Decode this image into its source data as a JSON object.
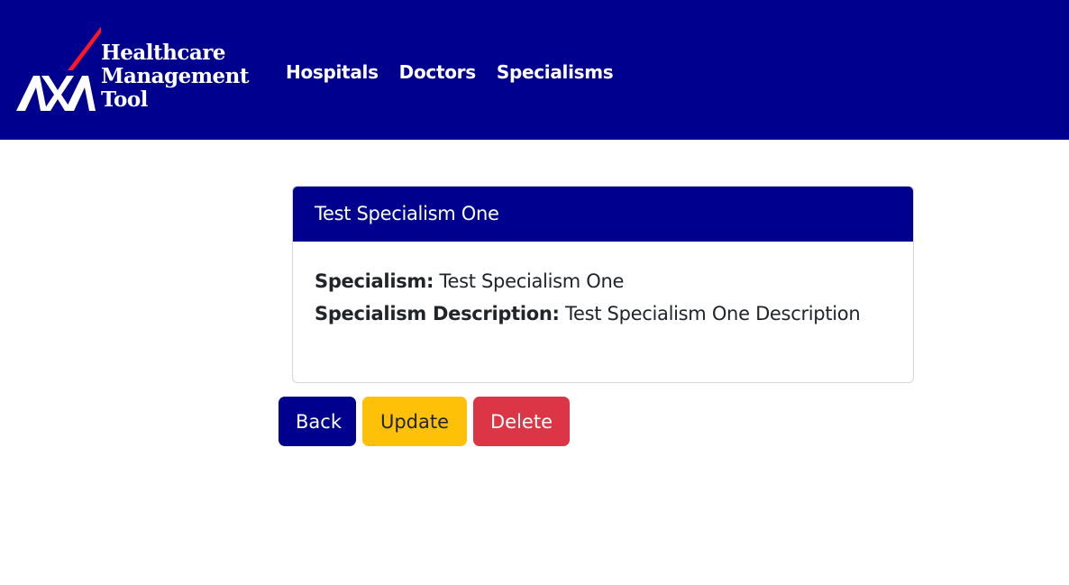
{
  "colors": {
    "brand": "#00008f",
    "warning": "#ffc107",
    "danger": "#dc3545",
    "logo_slash": "#ff1721"
  },
  "brand": {
    "logo_mark": "AXA",
    "line1": "Healthcare",
    "line2": "Management",
    "line3": "Tool"
  },
  "nav": {
    "hospitals": "Hospitals",
    "doctors": "Doctors",
    "specialisms": "Specialisms"
  },
  "card": {
    "title": "Test Specialism One",
    "fields": [
      {
        "label": "Specialism:",
        "value": "Test Specialism One"
      },
      {
        "label": "Specialism Description:",
        "value": "Test Specialism One Description"
      }
    ]
  },
  "actions": {
    "back": "Back",
    "update": "Update",
    "delete": "Delete"
  }
}
